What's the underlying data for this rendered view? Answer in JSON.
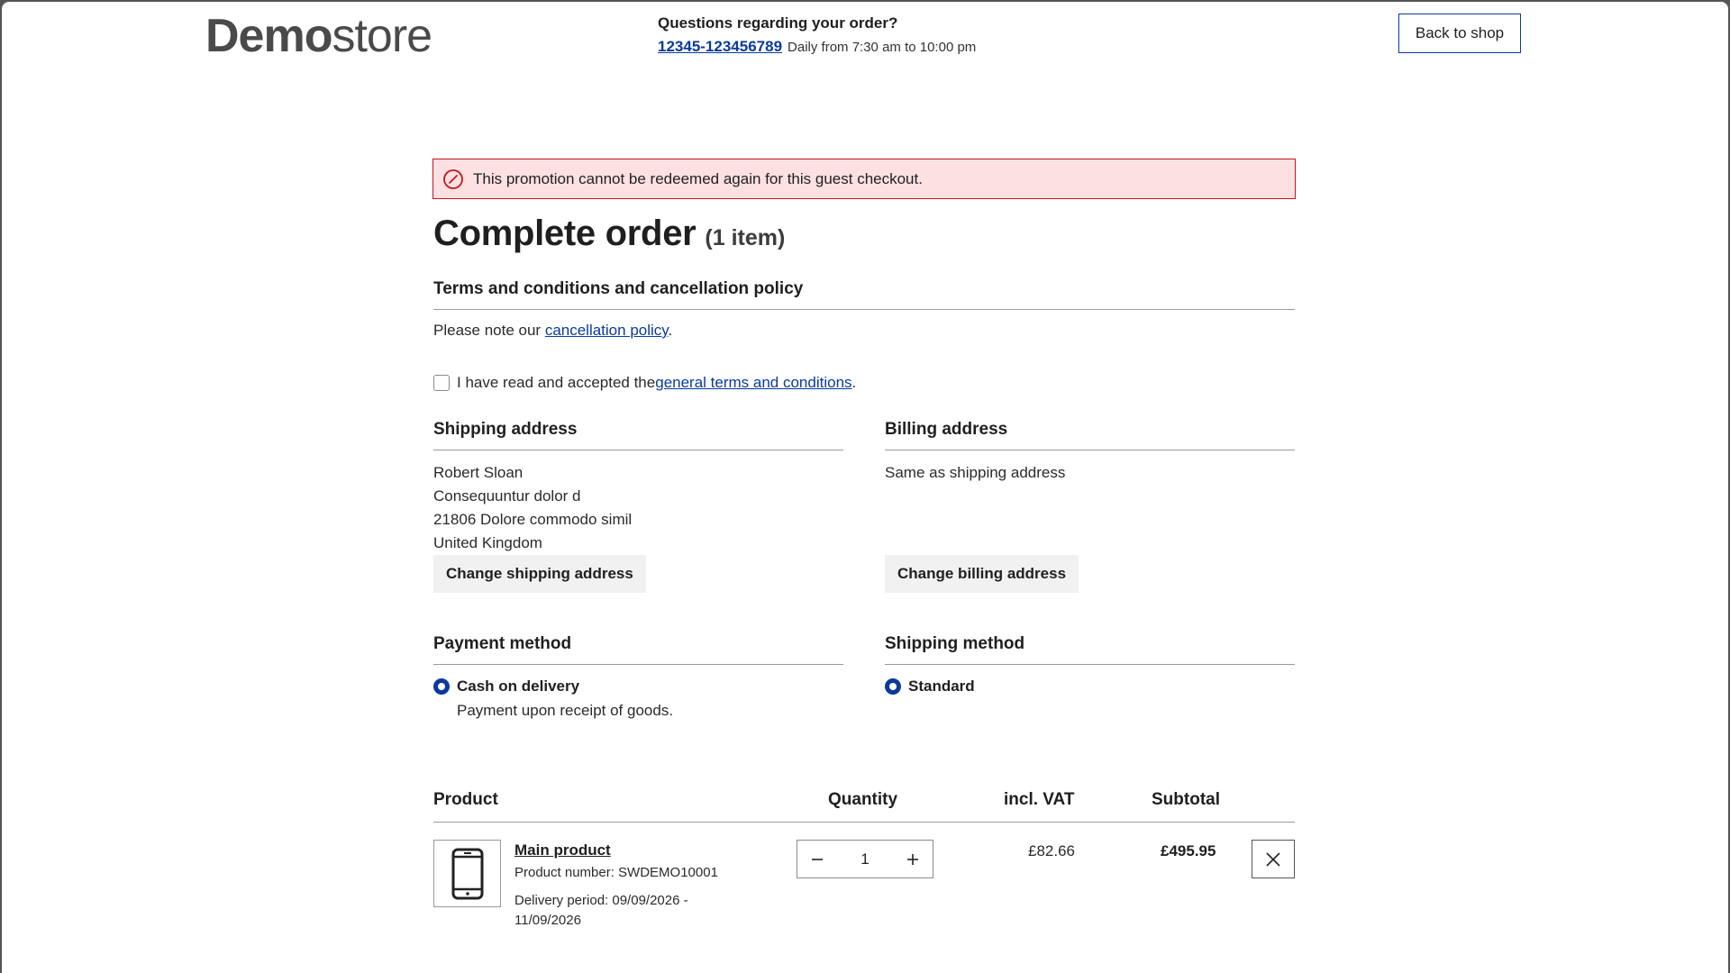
{
  "header": {
    "logo_bold": "Demo",
    "logo_thin": "store",
    "hotline_question": "Questions regarding your order?",
    "hotline_phone": "12345-123456789",
    "hotline_hours": "Daily from 7:30 am to 10:00 pm",
    "back_to_shop": "Back to shop"
  },
  "alert": {
    "message": "This promotion cannot be redeemed again for this guest checkout.",
    "color": "#c4161c",
    "background": "#fde0e2"
  },
  "title": {
    "text": "Complete order",
    "count": "(1 item)"
  },
  "terms": {
    "heading": "Terms and conditions and cancellation policy",
    "note_prefix": "Please note our ",
    "note_link": "cancellation policy",
    "note_suffix": ".",
    "checkbox_prefix": "I have read and accepted the ",
    "checkbox_link": "general terms and conditions",
    "checkbox_suffix": ".",
    "checked": false
  },
  "shipping_address": {
    "heading": "Shipping address",
    "lines": [
      "Robert Sloan",
      "Consequuntur dolor d",
      "21806 Dolore commodo simil",
      "United Kingdom"
    ],
    "change_label": "Change shipping address"
  },
  "billing_address": {
    "heading": "Billing address",
    "text": "Same as shipping address",
    "change_label": "Change billing address"
  },
  "payment_method": {
    "heading": "Payment method",
    "selected": "Cash on delivery",
    "description": "Payment upon receipt of goods."
  },
  "shipping_method": {
    "heading": "Shipping method",
    "selected": "Standard"
  },
  "table": {
    "headers": {
      "product": "Product",
      "quantity": "Quantity",
      "vat": "incl. VAT",
      "subtotal": "Subtotal"
    },
    "items": [
      {
        "name": "Main product",
        "product_number": "Product number: SWDEMO10001",
        "delivery": "Delivery period: 09/09/2026 - 11/09/2026",
        "icon": "smartphone-icon",
        "quantity": "1",
        "vat": "£82.66",
        "subtotal": "£495.95"
      }
    ]
  },
  "colors": {
    "accent": "#0b3a9a",
    "text": "#1f1f1f"
  }
}
